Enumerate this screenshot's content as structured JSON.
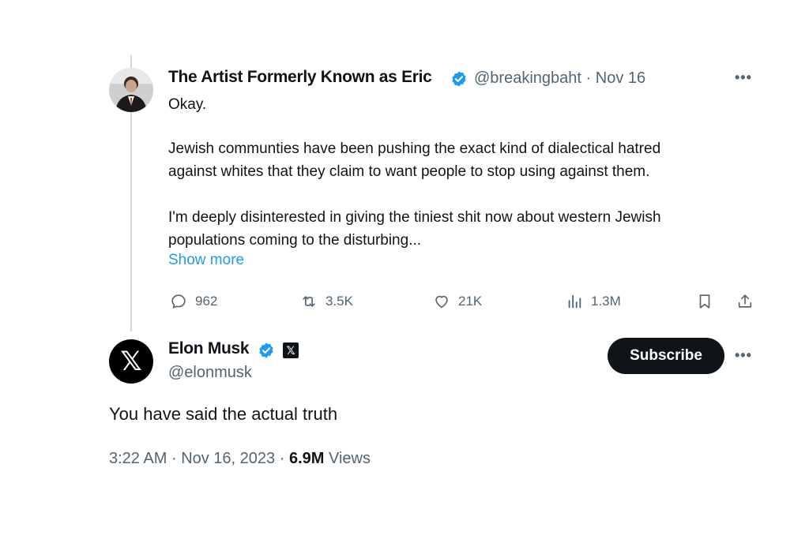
{
  "quoted_tweet": {
    "author_name": "The Artist Formerly Known as Eric",
    "handle": "@breakingbaht",
    "separator": "·",
    "date": "Nov 16",
    "lines": [
      "Okay.",
      "Jewish communties have been pushing the exact kind of dialectical hatred",
      "against whites that they claim to want people to stop using against them.",
      "I'm deeply disinterested in giving the tiniest shit now about western Jewish",
      "populations coming to the disturbing..."
    ],
    "show_more": "Show more",
    "stats": {
      "replies": "962",
      "reposts": "3.5K",
      "likes": "21K",
      "views": "1.3M"
    }
  },
  "main_tweet": {
    "author_name": "Elon Musk",
    "handle": "@elonmusk",
    "subscribe_label": "Subscribe",
    "text": "You have said the actual truth",
    "time": "3:22 AM",
    "date": "Nov 16, 2023",
    "views_count": "6.9M",
    "views_label": "Views"
  },
  "icons": {
    "verified": "verified-badge-icon",
    "more": "more-icon",
    "reply": "reply-icon",
    "repost": "repost-icon",
    "like": "heart-icon",
    "views": "views-icon",
    "bookmark": "bookmark-icon",
    "share": "share-icon",
    "x_logo": "x-logo-icon"
  },
  "colors": {
    "verified_blue": "#1d9bf0",
    "link_blue": "#1d9bf0",
    "secondary_text": "#536471",
    "primary_text": "#0f1419"
  }
}
